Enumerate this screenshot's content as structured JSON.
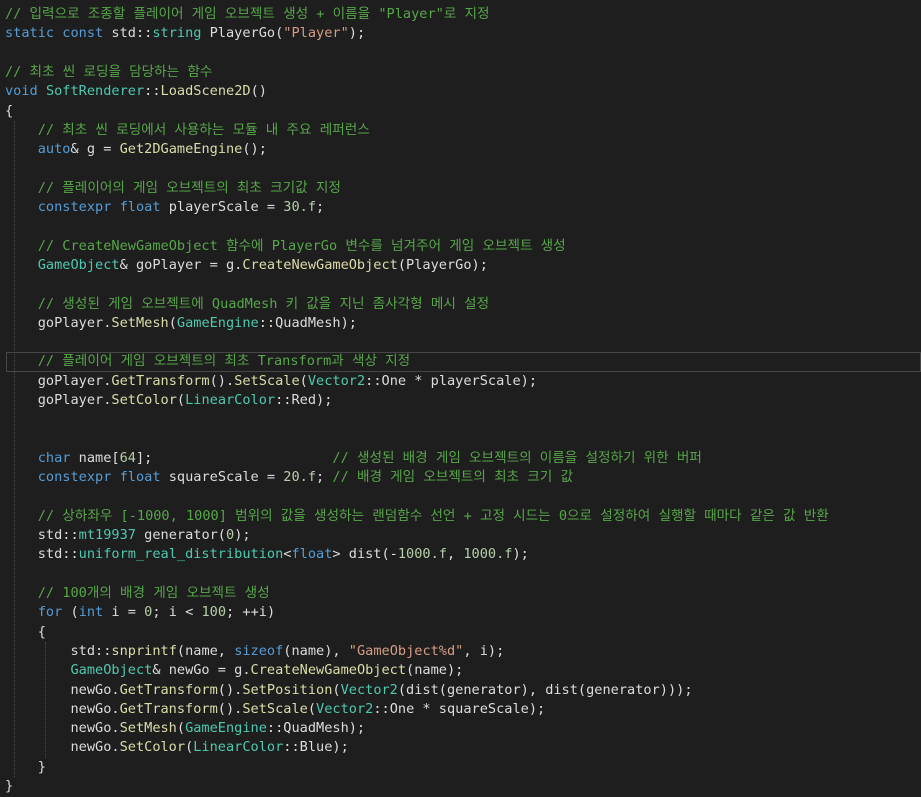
{
  "editor": {
    "colors": {
      "background": "#1e1e1e",
      "comment": "#57a64a",
      "keyword": "#569cd6",
      "type": "#4ec9b0",
      "function": "#dcdcaa",
      "string": "#d69d85",
      "number": "#b5cea8",
      "plain": "#dcdcdc"
    },
    "current_line_index": 18,
    "lines": [
      [
        [
          "cmt",
          "// 입력으로 조종할 플레이어 게임 오브젝트 생성 + 이름을 \"Player\"로 지정"
        ]
      ],
      [
        [
          "kw",
          "static"
        ],
        [
          "pl",
          " "
        ],
        [
          "kw",
          "const"
        ],
        [
          "pl",
          " std::"
        ],
        [
          "ty",
          "string"
        ],
        [
          "pl",
          " PlayerGo("
        ],
        [
          "st",
          "\"Player\""
        ],
        [
          "pl",
          ");"
        ]
      ],
      [],
      [
        [
          "cmt",
          "// 최초 씬 로딩을 담당하는 함수"
        ]
      ],
      [
        [
          "kw",
          "void"
        ],
        [
          "pl",
          " "
        ],
        [
          "ty",
          "SoftRenderer"
        ],
        [
          "pl",
          "::"
        ],
        [
          "fn",
          "LoadScene2D"
        ],
        [
          "pl",
          "()"
        ]
      ],
      [
        [
          "pl",
          "{"
        ]
      ],
      [
        [
          "pl",
          "    "
        ],
        [
          "cmt",
          "// 최초 씬 로딩에서 사용하는 모듈 내 주요 레퍼런스"
        ]
      ],
      [
        [
          "pl",
          "    "
        ],
        [
          "kw",
          "auto"
        ],
        [
          "pl",
          "& g = "
        ],
        [
          "fn",
          "Get2DGameEngine"
        ],
        [
          "pl",
          "();"
        ]
      ],
      [],
      [
        [
          "pl",
          "    "
        ],
        [
          "cmt",
          "// 플레이어의 게임 오브젝트의 최초 크기값 지정"
        ]
      ],
      [
        [
          "pl",
          "    "
        ],
        [
          "kw",
          "constexpr"
        ],
        [
          "pl",
          " "
        ],
        [
          "kw",
          "float"
        ],
        [
          "pl",
          " playerScale = "
        ],
        [
          "nm",
          "30.f"
        ],
        [
          "pl",
          ";"
        ]
      ],
      [],
      [
        [
          "pl",
          "    "
        ],
        [
          "cmt",
          "// CreateNewGameObject 함수에 PlayerGo 변수를 넘겨주어 게임 오브젝트 생성"
        ]
      ],
      [
        [
          "pl",
          "    "
        ],
        [
          "ty",
          "GameObject"
        ],
        [
          "pl",
          "& goPlayer = g."
        ],
        [
          "fn",
          "CreateNewGameObject"
        ],
        [
          "pl",
          "(PlayerGo);"
        ]
      ],
      [],
      [
        [
          "pl",
          "    "
        ],
        [
          "cmt",
          "// 생성된 게임 오브젝트에 QuadMesh 키 값을 지닌 좀사각형 메시 설정"
        ]
      ],
      [
        [
          "pl",
          "    goPlayer."
        ],
        [
          "fn",
          "SetMesh"
        ],
        [
          "pl",
          "("
        ],
        [
          "ty",
          "GameEngine"
        ],
        [
          "pl",
          "::QuadMesh);"
        ]
      ],
      [],
      [
        [
          "pl",
          "    "
        ],
        [
          "cmt",
          "// 플레이어 게임 오브젝트의 최초 Transform과 색상 지정"
        ]
      ],
      [
        [
          "pl",
          "    goPlayer."
        ],
        [
          "fn",
          "GetTransform"
        ],
        [
          "pl",
          "()."
        ],
        [
          "fn",
          "SetScale"
        ],
        [
          "pl",
          "("
        ],
        [
          "ty",
          "Vector2"
        ],
        [
          "pl",
          "::One * playerScale);"
        ]
      ],
      [
        [
          "pl",
          "    goPlayer."
        ],
        [
          "fn",
          "SetColor"
        ],
        [
          "pl",
          "("
        ],
        [
          "ty",
          "LinearColor"
        ],
        [
          "pl",
          "::Red);"
        ]
      ],
      [],
      [],
      [
        [
          "pl",
          "    "
        ],
        [
          "kw",
          "char"
        ],
        [
          "pl",
          " name["
        ],
        [
          "nm",
          "64"
        ],
        [
          "pl",
          "];                      "
        ],
        [
          "cmt",
          "// 생성된 배경 게임 오브젝트의 이름을 설정하기 위한 버퍼"
        ]
      ],
      [
        [
          "pl",
          "    "
        ],
        [
          "kw",
          "constexpr"
        ],
        [
          "pl",
          " "
        ],
        [
          "kw",
          "float"
        ],
        [
          "pl",
          " squareScale = "
        ],
        [
          "nm",
          "20.f"
        ],
        [
          "pl",
          "; "
        ],
        [
          "cmt",
          "// 배경 게임 오브젝트의 최초 크기 값"
        ]
      ],
      [],
      [
        [
          "pl",
          "    "
        ],
        [
          "cmt",
          "// 상하좌우 [-1000, 1000] 범위의 값을 생성하는 랜덤함수 선언 + 고정 시드는 0으로 설정하여 실행할 때마다 같은 값 반환"
        ]
      ],
      [
        [
          "pl",
          "    std::"
        ],
        [
          "ty",
          "mt19937"
        ],
        [
          "pl",
          " generator("
        ],
        [
          "nm",
          "0"
        ],
        [
          "pl",
          ");"
        ]
      ],
      [
        [
          "pl",
          "    std::"
        ],
        [
          "ty",
          "uniform_real_distribution"
        ],
        [
          "pl",
          "<"
        ],
        [
          "kw",
          "float"
        ],
        [
          "pl",
          "> dist(-"
        ],
        [
          "nm",
          "1000.f"
        ],
        [
          "pl",
          ", "
        ],
        [
          "nm",
          "1000.f"
        ],
        [
          "pl",
          ");"
        ]
      ],
      [],
      [
        [
          "pl",
          "    "
        ],
        [
          "cmt",
          "// 100개의 배경 게임 오브젝트 생성"
        ]
      ],
      [
        [
          "pl",
          "    "
        ],
        [
          "kw",
          "for"
        ],
        [
          "pl",
          " ("
        ],
        [
          "kw",
          "int"
        ],
        [
          "pl",
          " i = "
        ],
        [
          "nm",
          "0"
        ],
        [
          "pl",
          "; i < "
        ],
        [
          "nm",
          "100"
        ],
        [
          "pl",
          "; ++i)"
        ]
      ],
      [
        [
          "pl",
          "    {"
        ]
      ],
      [
        [
          "pl",
          "        std::"
        ],
        [
          "fn",
          "snprintf"
        ],
        [
          "pl",
          "(name, "
        ],
        [
          "kw",
          "sizeof"
        ],
        [
          "pl",
          "(name), "
        ],
        [
          "st",
          "\"GameObject%d\""
        ],
        [
          "pl",
          ", i);"
        ]
      ],
      [
        [
          "pl",
          "        "
        ],
        [
          "ty",
          "GameObject"
        ],
        [
          "pl",
          "& newGo = g."
        ],
        [
          "fn",
          "CreateNewGameObject"
        ],
        [
          "pl",
          "(name);"
        ]
      ],
      [
        [
          "pl",
          "        newGo."
        ],
        [
          "fn",
          "GetTransform"
        ],
        [
          "pl",
          "()."
        ],
        [
          "fn",
          "SetPosition"
        ],
        [
          "pl",
          "("
        ],
        [
          "ty",
          "Vector2"
        ],
        [
          "pl",
          "(dist(generator), dist(generator)));"
        ]
      ],
      [
        [
          "pl",
          "        newGo."
        ],
        [
          "fn",
          "GetTransform"
        ],
        [
          "pl",
          "()."
        ],
        [
          "fn",
          "SetScale"
        ],
        [
          "pl",
          "("
        ],
        [
          "ty",
          "Vector2"
        ],
        [
          "pl",
          "::One * squareScale);"
        ]
      ],
      [
        [
          "pl",
          "        newGo."
        ],
        [
          "fn",
          "SetMesh"
        ],
        [
          "pl",
          "("
        ],
        [
          "ty",
          "GameEngine"
        ],
        [
          "pl",
          "::QuadMesh);"
        ]
      ],
      [
        [
          "pl",
          "        newGo."
        ],
        [
          "fn",
          "SetColor"
        ],
        [
          "pl",
          "("
        ],
        [
          "ty",
          "LinearColor"
        ],
        [
          "pl",
          "::Blue);"
        ]
      ],
      [
        [
          "pl",
          "    }"
        ]
      ],
      [
        [
          "pl",
          "}"
        ]
      ]
    ]
  }
}
